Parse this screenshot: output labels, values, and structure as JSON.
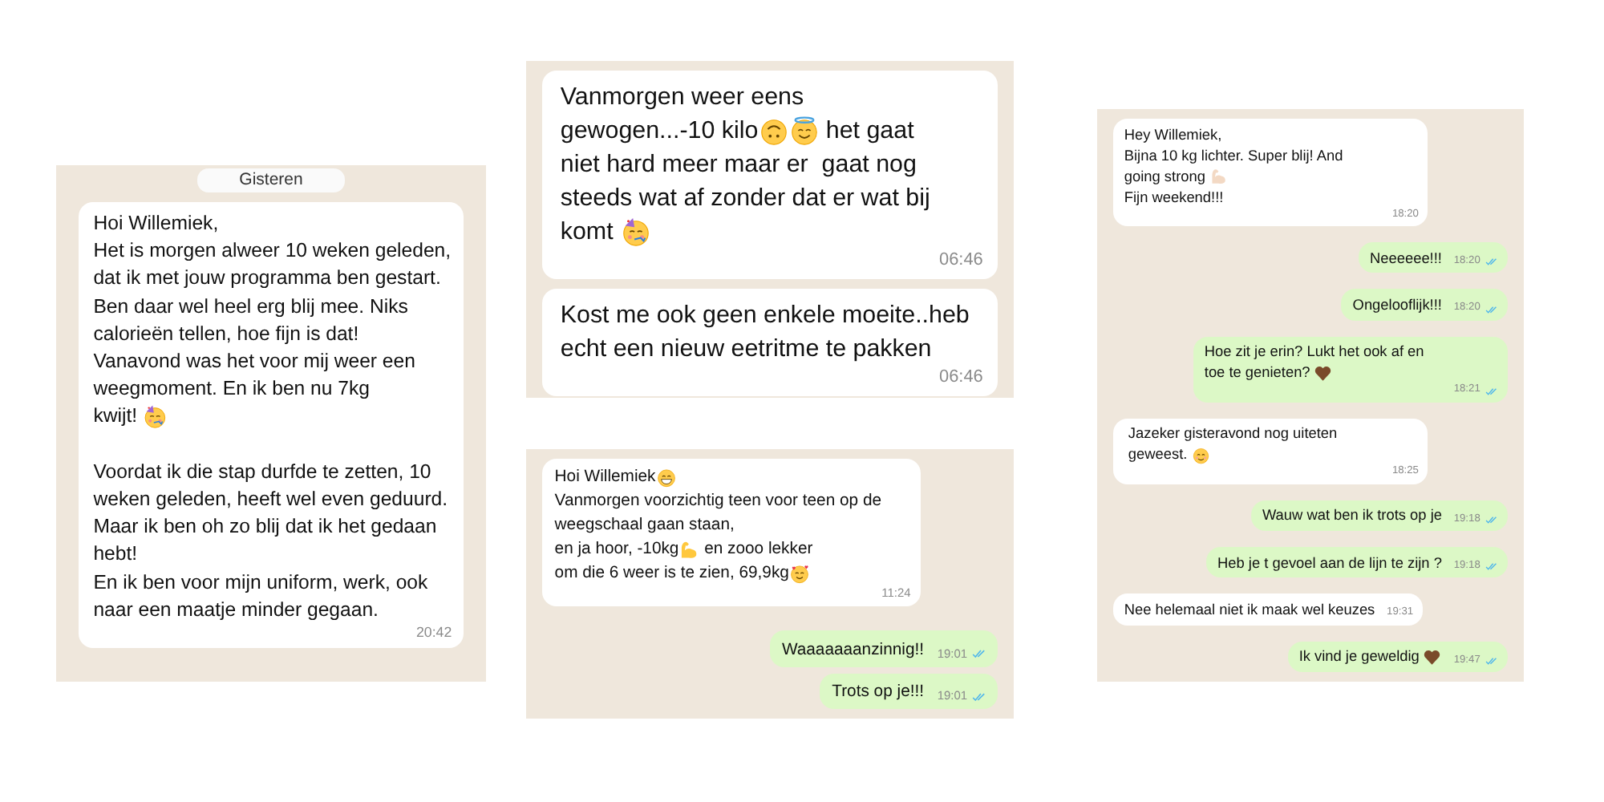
{
  "panels": [
    {
      "date_chip": "Gisteren",
      "messages": [
        {
          "kind": "incoming",
          "parts": [
            {
              "kind": "text",
              "text": "Hoi Willemiek,\nHet is morgen alweer 10 weken geleden, dat ik met jouw programma ben gestart. Ben daar wel heel erg blij mee. Niks calorieën tellen, hoe fijn is dat!\nVanavond was het voor mij weer een weegmoment. En ik ben nu 7kg"
            },
            {
              "kind": "text",
              "text": "kwijt! "
            },
            {
              "kind": "party"
            },
            {
              "kind": "text",
              "text": "\n\nVoordat ik die stap durfde te zetten, 10 weken geleden, heeft wel even geduurd. Maar ik ben oh zo blij dat ik het gedaan hebt!\nEn ik ben voor mijn uniform, werk, ook naar een maatje minder gegaan."
            }
          ],
          "time": "20:42"
        }
      ]
    },
    {
      "messages": [
        {
          "kind": "incoming",
          "parts": [
            {
              "kind": "text",
              "text": "Vanmorgen weer eens"
            },
            {
              "kind": "text",
              "text": "\ngewogen...-10 kilo"
            },
            {
              "kind": "upside"
            },
            {
              "kind": "halo"
            },
            {
              "kind": "text",
              "text": " het gaat"
            },
            {
              "kind": "text",
              "text": "niet hard meer maar er  gaat nog steeds wat af zonder dat er wat bij"
            },
            {
              "kind": "text",
              "text": "\nkomt "
            },
            {
              "kind": "party"
            }
          ],
          "time": "06:46"
        },
        {
          "kind": "incoming",
          "parts": [
            {
              "kind": "text",
              "text": "Kost me ook geen enkele moeite..heb echt een nieuw eetritme te pakken"
            }
          ],
          "time": "06:46"
        }
      ]
    },
    {
      "messages": [
        {
          "kind": "incoming",
          "parts": [
            {
              "kind": "text",
              "text": "Hoi Willemiek"
            },
            {
              "kind": "grin"
            },
            {
              "kind": "text",
              "text": "\nVanmorgen voorzichtig teen voor teen op de weegschaal gaan staan,"
            },
            {
              "kind": "text",
              "text": "\nen ja hoor, -10kg"
            },
            {
              "kind": "muscle",
              "color": "#ffc83d"
            },
            {
              "kind": "text",
              "text": " en zooo lekker"
            },
            {
              "kind": "text",
              "text": "\nom die 6 weer is te zien, 69,9kg"
            },
            {
              "kind": "hearts"
            }
          ],
          "time": "11:24"
        },
        {
          "kind": "outgoing",
          "read": true,
          "parts": [
            {
              "kind": "text",
              "text": "Waaaaaaanzinnig!!"
            }
          ],
          "time": "19:01"
        },
        {
          "kind": "outgoing",
          "read": true,
          "parts": [
            {
              "kind": "text",
              "text": "Trots op je!!!"
            }
          ],
          "time": "19:01"
        }
      ]
    },
    {
      "messages": [
        {
          "kind": "incoming",
          "parts": [
            {
              "kind": "text",
              "text": "Hey Willemiek,\nBijna 10 kg lichter. Super blij! And"
            },
            {
              "kind": "text",
              "text": "\ngoing strong "
            },
            {
              "kind": "muscle",
              "color": "#f3d9c4"
            },
            {
              "kind": "text",
              "text": "\nFijn weekend!!!"
            }
          ],
          "time": "18:20"
        },
        {
          "kind": "outgoing",
          "read": true,
          "parts": [
            {
              "kind": "text",
              "text": "Neeeeee!!!"
            }
          ],
          "time": "18:20"
        },
        {
          "kind": "outgoing",
          "read": true,
          "parts": [
            {
              "kind": "text",
              "text": "Ongelooflijk!!!"
            }
          ],
          "time": "18:20"
        },
        {
          "kind": "outgoing",
          "read": true,
          "parts": [
            {
              "kind": "text",
              "text": "Hoe zit je erin? Lukt het ook af en"
            },
            {
              "kind": "text",
              "text": "\ntoe te genieten? "
            },
            {
              "kind": "heart"
            }
          ],
          "time": "18:21"
        },
        {
          "kind": "incoming",
          "parts": [
            {
              "kind": "text",
              "text": "Jazeker gisteravond nog uiteten"
            },
            {
              "kind": "text",
              "text": "\ngeweest. "
            },
            {
              "kind": "smile"
            }
          ],
          "time": "18:25"
        },
        {
          "kind": "outgoing",
          "read": true,
          "parts": [
            {
              "kind": "text",
              "text": "Wauw wat ben ik trots op je"
            }
          ],
          "time": "19:18"
        },
        {
          "kind": "outgoing",
          "read": true,
          "parts": [
            {
              "kind": "text",
              "text": "Heb je t gevoel aan de lijn te zijn ?"
            }
          ],
          "time": "19:18"
        },
        {
          "kind": "incoming",
          "parts": [
            {
              "kind": "text",
              "text": "Nee helemaal niet ik maak wel keuzes"
            }
          ],
          "time": "19:31"
        },
        {
          "kind": "outgoing",
          "read": true,
          "parts": [
            {
              "kind": "text",
              "text": "Ik vind je geweldig "
            },
            {
              "kind": "heart"
            }
          ],
          "time": "19:47"
        }
      ]
    }
  ]
}
